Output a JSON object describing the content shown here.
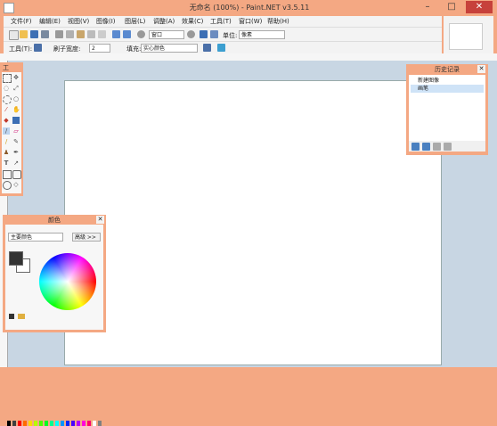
{
  "window": {
    "title": "无命名 (100%) - Paint.NET v3.5.11",
    "close_glyph": "✕",
    "maximize_glyph": "□",
    "minimize_glyph": "–"
  },
  "menu": [
    "文件(F)",
    "编辑(E)",
    "视图(V)",
    "图像(I)",
    "图层(L)",
    "调整(A)",
    "效果(C)",
    "工具(T)",
    "窗口(W)",
    "帮助(H)"
  ],
  "toolbar": {
    "zoom_select": "窗口",
    "units_label": "单位:",
    "units_value": "像素",
    "tool_label": "工具(T):",
    "brush_label": "刷子宽度:",
    "brush_value": "2",
    "fill_label": "填充:",
    "fill_value": "实心颜色"
  },
  "panels": {
    "tools_title": "工",
    "history_title": "历史记录",
    "colors_title": "颜色",
    "close_glyph": "✕"
  },
  "history": [
    "新建图像",
    "画笔"
  ],
  "colors": {
    "mode_select": "主要颜色",
    "more_button": "高级 >>"
  },
  "palette": [
    "#000000",
    "#404040",
    "#ff0000",
    "#ff6a00",
    "#ffd800",
    "#b6ff00",
    "#4cff00",
    "#00ff21",
    "#00ff90",
    "#00ffff",
    "#0094ff",
    "#0026ff",
    "#4800ff",
    "#b200ff",
    "#ff00dc",
    "#ff006e",
    "#ffffff",
    "#808080"
  ],
  "colors_theme": {
    "accent": "#f4a883",
    "workspace": "#c8d6e3",
    "primary_swatch": "#333333",
    "close_button": "#c7413b"
  }
}
